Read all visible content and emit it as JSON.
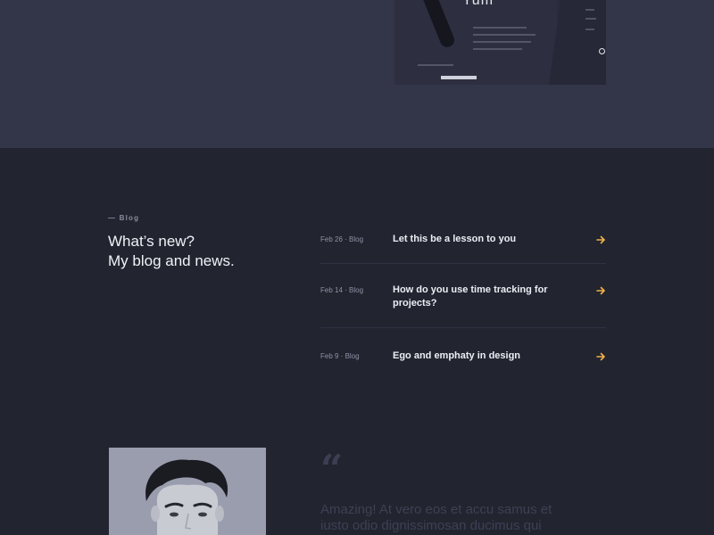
{
  "blog": {
    "eyebrow": "— Blog",
    "heading_line1": "What’s new?",
    "heading_line2": "My blog and news.",
    "posts": [
      {
        "meta": "Feb 26 · Blog",
        "title": "Let this be a lesson to you",
        "arrow_icon": "arrow-right-icon"
      },
      {
        "meta": "Feb 14 · Blog",
        "title": "How do you use time tracking for projects?",
        "arrow_icon": "arrow-right-icon"
      },
      {
        "meta": "Feb 9 · Blog",
        "title": "Ego and emphaty in design",
        "arrow_icon": "arrow-right-icon"
      }
    ]
  },
  "testimonial": {
    "quote_icon": "quote-icon",
    "text_line1": "Amazing! At vero eos et accu samus et",
    "text_line2": "iusto odio dignissimosan ducimus qui"
  },
  "colors": {
    "top_band_bg": "#333548",
    "page_bg": "#22242f",
    "accent_arrow": "#f0b04a",
    "heading_text": "#f1f2f7",
    "muted_text": "#8f92a6"
  }
}
